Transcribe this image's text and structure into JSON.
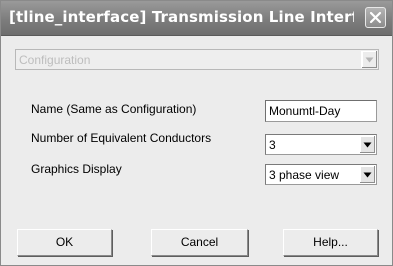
{
  "window": {
    "title": "[tline_interface] Transmission Line Interf..."
  },
  "configuration": {
    "selected": "Configuration",
    "disabled": true
  },
  "fields": {
    "name": {
      "label": "Name (Same as Configuration)",
      "value": "Monumtl-Day"
    },
    "conductors": {
      "label": "Number of Equivalent Conductors",
      "selected": "3"
    },
    "graphics": {
      "label": "Graphics Display",
      "selected": "3 phase view"
    }
  },
  "buttons": {
    "ok": "OK",
    "cancel": "Cancel",
    "help": "Help..."
  },
  "icons": {
    "close": "close-icon",
    "dropdown": "chevron-down-icon"
  },
  "colors": {
    "titlebar": "#7d7d7d",
    "dialog_background": "#ececec"
  }
}
